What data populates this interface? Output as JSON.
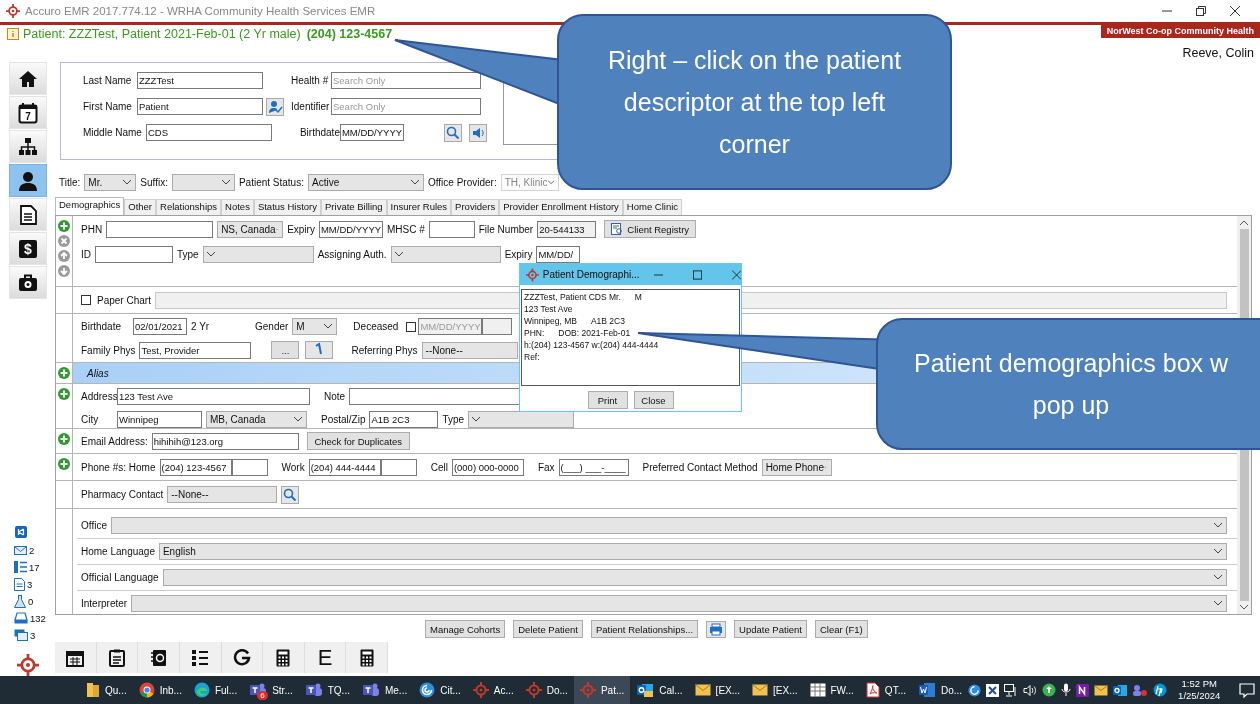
{
  "window": {
    "title": "Accuro EMR 2017.774.12 - WRHA Community Health Services EMR"
  },
  "patient_banner": {
    "descriptor": "Patient: ZZZTest, Patient 2021-Feb-01 (2 Yr male)",
    "phone": "(204) 123-4567"
  },
  "clinic_badge": "NorWest Co-op Community Health",
  "user": "Reeve, Colin",
  "nav": [
    {
      "kind": "home",
      "selected": false
    },
    {
      "kind": "calendar",
      "text": "7",
      "selected": false
    },
    {
      "kind": "chart",
      "selected": false
    },
    {
      "kind": "person",
      "selected": true
    },
    {
      "kind": "document",
      "selected": false
    },
    {
      "kind": "dollar",
      "text": "$",
      "selected": false
    },
    {
      "kind": "toolbox",
      "selected": false
    }
  ],
  "search": {
    "last_name": {
      "label": "Last Name",
      "value": "ZZZTest"
    },
    "first_name": {
      "label": "First Name",
      "value": "Patient"
    },
    "middle_name": {
      "label": "Middle Name",
      "value": "CDS"
    },
    "health": {
      "label": "Health #",
      "placeholder": "Search Only"
    },
    "identifier": {
      "label": "Identifier",
      "placeholder": "Search Only"
    },
    "birthdate": {
      "label": "Birthdate",
      "value": "MM/DD/YYYY"
    }
  },
  "title_row": [
    {
      "label": "Title:",
      "value": "Mr.",
      "disabled": false
    },
    {
      "label": "Suffix:",
      "disabled": false
    },
    {
      "label": "Patient Status:",
      "value": "Active",
      "disabled": false
    },
    {
      "label": "Office Provider:",
      "value": "TH, Klinic",
      "disabled": true
    }
  ],
  "tabs": [
    {
      "label": "Demographics",
      "selected": true
    },
    {
      "label": "Other",
      "selected": false
    },
    {
      "label": "Relationships",
      "selected": false
    },
    {
      "label": "Notes",
      "selected": false
    },
    {
      "label": "Status History",
      "selected": false
    },
    {
      "label": "Private Billing",
      "selected": false
    },
    {
      "label": "Insurer Rules",
      "selected": false
    },
    {
      "label": "Providers",
      "selected": false
    },
    {
      "label": "Provider Enrollment History",
      "selected": false
    },
    {
      "label": "Home Clinic",
      "selected": false
    }
  ],
  "ids": {
    "phn_label": "PHN",
    "province": "NS, Canada",
    "expiry_label": "Expiry",
    "expiry": "MM/DD/YYYY",
    "mhsc_label": "MHSC #",
    "file_label": "File Number",
    "file_number": "20-544133",
    "registry_button": "Client Registry",
    "id_label": "ID",
    "type_label": "Type",
    "auth_label": "Assigning Auth.",
    "id_expiry_label": "Expiry",
    "id_expiry": "MM/DD/"
  },
  "paper_chart": {
    "label": "Paper Chart",
    "checked": false
  },
  "birth": {
    "birthdate_label": "Birthdate",
    "birthdate": "02/01/2021",
    "age": "2 Yr",
    "gender_label": "Gender",
    "gender": "M",
    "deceased_label": "Deceased",
    "deceased": false,
    "deceased_date": "MM/DD/YYYY",
    "family_label": "Family Phys",
    "family": "Test, Provider",
    "more_button": "...",
    "referring_label": "Referring Phys",
    "referring": "--None--"
  },
  "alias": {
    "label": "Alias"
  },
  "address": {
    "address_label": "Address",
    "address": "123 Test Ave",
    "note_label": "Note",
    "city_label": "City",
    "city": "Winnipeg",
    "province": "MB, Canada",
    "postal_label": "Postal/Zip",
    "postal": "A1B 2C3",
    "type_label": "Type"
  },
  "email": {
    "label": "Email Address:",
    "value": "hihihih@123.org",
    "button": "Check for Duplicates"
  },
  "phones": {
    "home_label": "Phone #s: Home",
    "home": "(204) 123-4567",
    "work_label": "Work",
    "work": "(204) 444-4444",
    "cell_label": "Cell",
    "cell": "(000) 000-0000",
    "fax_label": "Fax",
    "fax": "(___) ___-____",
    "preferred_label": "Preferred Contact Method",
    "preferred": "Home Phone"
  },
  "pharmacy": {
    "label": "Pharmacy Contact",
    "value": "--None--"
  },
  "other": [
    {
      "label": "Office"
    },
    {
      "label": "Home Language",
      "value": "English"
    },
    {
      "label": "Official Language"
    },
    {
      "label": "Interpreter"
    }
  ],
  "actions": [
    {
      "kind": "button",
      "label": "Manage Cohorts"
    },
    {
      "kind": "button",
      "label": "Delete Patient"
    },
    {
      "kind": "button",
      "label": "Patient Relationships..."
    },
    {
      "kind": "print"
    },
    {
      "kind": "button",
      "label": "Update Patient"
    },
    {
      "kind": "button",
      "label": "Clear (F1)"
    }
  ],
  "counters": [
    {
      "kind": "mail",
      "count": "2"
    },
    {
      "kind": "list",
      "count": "17"
    },
    {
      "kind": "document",
      "count": "3"
    },
    {
      "kind": "lab",
      "count": "0"
    },
    {
      "kind": "scanner",
      "count": "132"
    },
    {
      "kind": "messages",
      "count": "3"
    }
  ],
  "toolbar": [
    {
      "kind": "calendar"
    },
    {
      "kind": "clipboard"
    },
    {
      "kind": "contacts"
    },
    {
      "kind": "list"
    },
    {
      "kind": "refresh"
    },
    {
      "kind": "calculator"
    },
    {
      "kind": "letter",
      "text": "E"
    },
    {
      "kind": "calculator"
    }
  ],
  "popup": {
    "title": "Patient Demographi...",
    "lines": [
      [
        "ZZZTest, Patient CDS Mr.",
        "M"
      ],
      [
        "123 Test Ave"
      ],
      [
        "Winnipeg, MB",
        "A1B 2C3"
      ],
      [
        "PHN:",
        "DOB: 2021-Feb-01"
      ],
      [
        "h:(204) 123-4567 w:(204) 444-4444"
      ],
      [
        "Ref:"
      ]
    ],
    "buttons": [
      "Print",
      "Close"
    ]
  },
  "callouts": [
    {
      "lines": [
        "Right – click on the patient",
        "descriptor at the top left",
        "corner"
      ]
    },
    {
      "lines": [
        "Patient demographics box w",
        "pop up"
      ]
    }
  ],
  "taskbar": {
    "apps": [
      {
        "kind": "folder",
        "label": "Qu...",
        "selected": false
      },
      {
        "kind": "chrome",
        "label": "Inb...",
        "selected": false
      },
      {
        "kind": "edge",
        "label": "Ful...",
        "selected": false
      },
      {
        "kind": "teams",
        "label": "Str...",
        "badge": "6",
        "selected": false
      },
      {
        "kind": "teams",
        "label": "TQ...",
        "selected": false
      },
      {
        "kind": "teams",
        "label": "Me...",
        "selected": false
      },
      {
        "kind": "citrix",
        "label": "Cit...",
        "selected": false
      },
      {
        "kind": "accuro",
        "label": "Ac...",
        "selected": false
      },
      {
        "kind": "accuro",
        "label": "Do...",
        "selected": false
      },
      {
        "kind": "accuro",
        "label": "Pat...",
        "selected": true
      },
      {
        "kind": "outlook",
        "label": "Cal...",
        "selected": false
      },
      {
        "kind": "mail",
        "label": "[EX...",
        "selected": false
      },
      {
        "kind": "mail",
        "label": "[EX...",
        "selected": false
      },
      {
        "kind": "sheet",
        "label": "FW...",
        "selected": false
      },
      {
        "kind": "pdf",
        "label": "QT...",
        "selected": false
      },
      {
        "kind": "word",
        "label": "Do...",
        "selected": false
      }
    ],
    "time": "1:52 PM",
    "date": "1/25/2024"
  }
}
